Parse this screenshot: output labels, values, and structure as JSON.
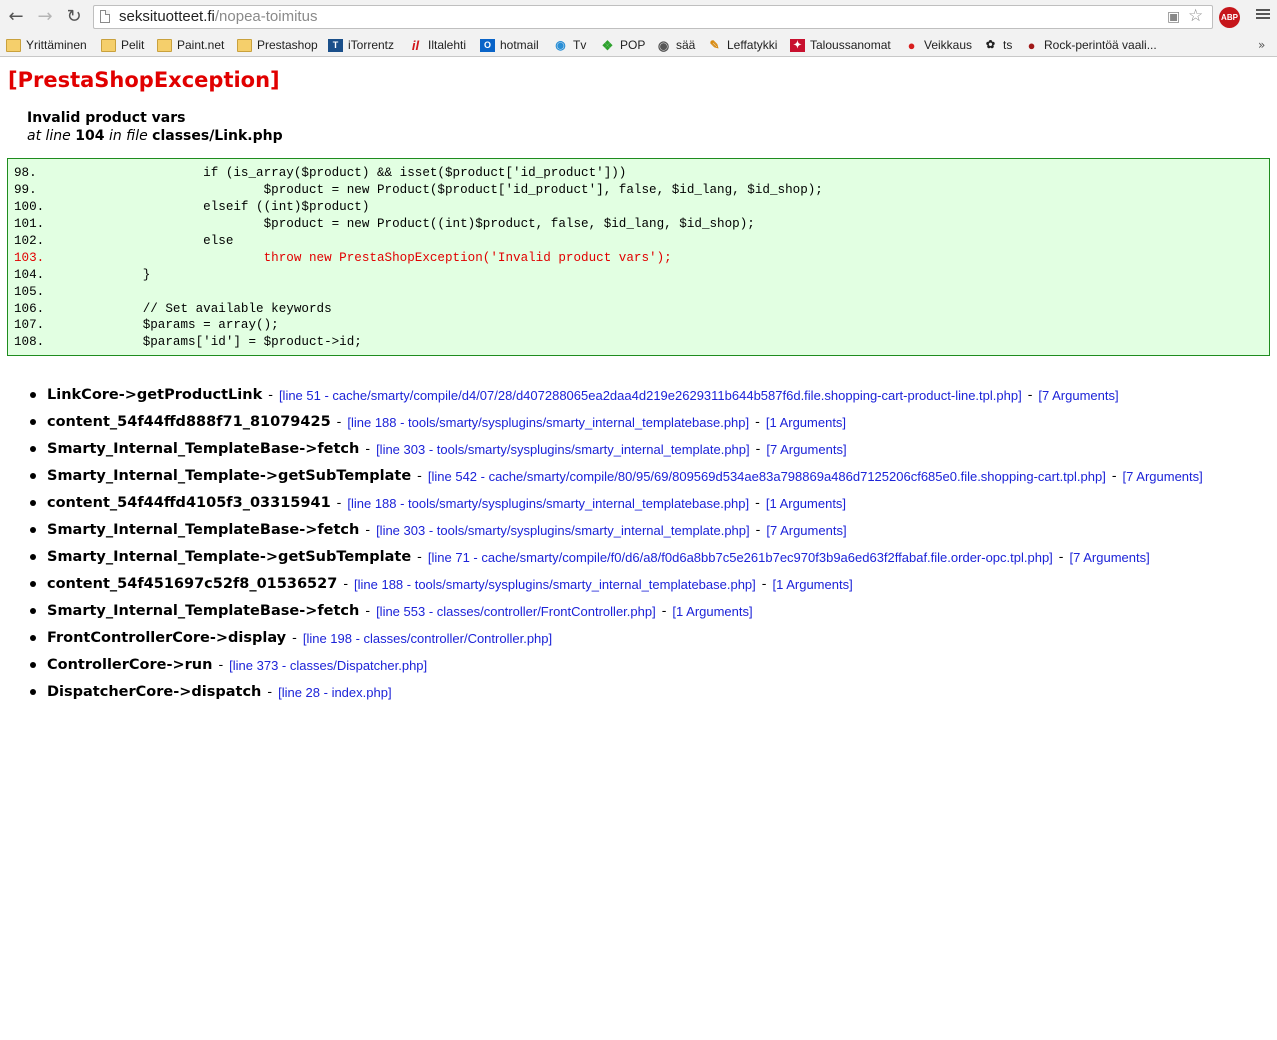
{
  "browser": {
    "url_domain": "seksituotteet.fi",
    "url_path": "/nopea-toimitus",
    "adblock_label": "ABP"
  },
  "bookmarks": [
    {
      "label": "Yrittäminen",
      "icon": "folder-icon"
    },
    {
      "label": "Pelit",
      "icon": "folder-icon"
    },
    {
      "label": "Paint.net",
      "icon": "folder-icon"
    },
    {
      "label": "Prestashop",
      "icon": "folder-icon"
    },
    {
      "label": "iTorrentz",
      "icon": "torrentz-icon"
    },
    {
      "label": "Iltalehti",
      "icon": "iltalehti-icon"
    },
    {
      "label": "hotmail",
      "icon": "outlook-icon"
    },
    {
      "label": "Tv",
      "icon": "tv-icon"
    },
    {
      "label": "POP",
      "icon": "pop-icon"
    },
    {
      "label": "sää",
      "icon": "weather-icon"
    },
    {
      "label": "Leffatykki",
      "icon": "leffatykki-icon"
    },
    {
      "label": "Taloussanomat",
      "icon": "taloussanomat-icon"
    },
    {
      "label": "Veikkaus",
      "icon": "veikkaus-icon"
    },
    {
      "label": "ts",
      "icon": "ts-icon"
    },
    {
      "label": "Rock-perintöä vaali...",
      "icon": "rock-icon"
    }
  ],
  "exception": {
    "title": "[PrestaShopException]",
    "message": "Invalid product vars",
    "at_line_text": "at line",
    "line": "104",
    "in_file_text": "in file",
    "file": "classes/Link.php"
  },
  "code": [
    {
      "num": "98.",
      "text": "                    if (is_array($product) && isset($product['id_product']))",
      "error": false
    },
    {
      "num": "99.",
      "text": "                            $product = new Product($product['id_product'], false, $id_lang, $id_shop);",
      "error": false
    },
    {
      "num": "100.",
      "text": "                    elseif ((int)$product)",
      "error": false
    },
    {
      "num": "101.",
      "text": "                            $product = new Product((int)$product, false, $id_lang, $id_shop);",
      "error": false
    },
    {
      "num": "102.",
      "text": "                    else",
      "error": false
    },
    {
      "num": "103.",
      "text": "                            throw new PrestaShopException('Invalid product vars');",
      "error": true
    },
    {
      "num": "104.",
      "text": "            }",
      "error": false
    },
    {
      "num": "105.",
      "text": "",
      "error": false
    },
    {
      "num": "106.",
      "text": "            // Set available keywords",
      "error": false
    },
    {
      "num": "107.",
      "text": "            $params = array();",
      "error": false
    },
    {
      "num": "108.",
      "text": "            $params['id'] = $product->id;",
      "error": false
    }
  ],
  "trace": [
    {
      "fn": "LinkCore->getProductLink",
      "location": "[line 51 - cache/smarty/compile/d4/07/28/d407288065ea2daa4d219e2629311b644b587f6d.file.shopping-cart-product-line.tpl.php]",
      "args": "[7 Arguments]"
    },
    {
      "fn": "content_54f44ffd888f71_81079425",
      "location": "[line 188 - tools/smarty/sysplugins/smarty_internal_templatebase.php]",
      "args": "[1 Arguments]"
    },
    {
      "fn": "Smarty_Internal_TemplateBase->fetch",
      "location": "[line 303 - tools/smarty/sysplugins/smarty_internal_template.php]",
      "args": "[7 Arguments]"
    },
    {
      "fn": "Smarty_Internal_Template->getSubTemplate",
      "location": "[line 542 - cache/smarty/compile/80/95/69/809569d534ae83a798869a486d7125206cf685e0.file.shopping-cart.tpl.php]",
      "args": "[7 Arguments]"
    },
    {
      "fn": "content_54f44ffd4105f3_03315941",
      "location": "[line 188 - tools/smarty/sysplugins/smarty_internal_templatebase.php]",
      "args": "[1 Arguments]"
    },
    {
      "fn": "Smarty_Internal_TemplateBase->fetch",
      "location": "[line 303 - tools/smarty/sysplugins/smarty_internal_template.php]",
      "args": "[7 Arguments]"
    },
    {
      "fn": "Smarty_Internal_Template->getSubTemplate",
      "location": "[line 71 - cache/smarty/compile/f0/d6/a8/f0d6a8bb7c5e261b7ec970f3b9a6ed63f2ffabaf.file.order-opc.tpl.php]",
      "args": "[7 Arguments]"
    },
    {
      "fn": "content_54f451697c52f8_01536527",
      "location": "[line 188 - tools/smarty/sysplugins/smarty_internal_templatebase.php]",
      "args": "[1 Arguments]"
    },
    {
      "fn": "Smarty_Internal_TemplateBase->fetch",
      "location": "[line 553 - classes/controller/FrontController.php]",
      "args": "[1 Arguments]"
    },
    {
      "fn": "FrontControllerCore->display",
      "location": "[line 198 - classes/controller/Controller.php]",
      "args": ""
    },
    {
      "fn": "ControllerCore->run",
      "location": "[line 373 - classes/Dispatcher.php]",
      "args": ""
    },
    {
      "fn": "DispatcherCore->dispatch",
      "location": "[line 28 - index.php]",
      "args": ""
    }
  ],
  "colors": {
    "exception_red": "#e10000",
    "code_bg": "#e2ffe2",
    "code_border": "#1e8c1e",
    "link_blue": "#1c23d8"
  }
}
